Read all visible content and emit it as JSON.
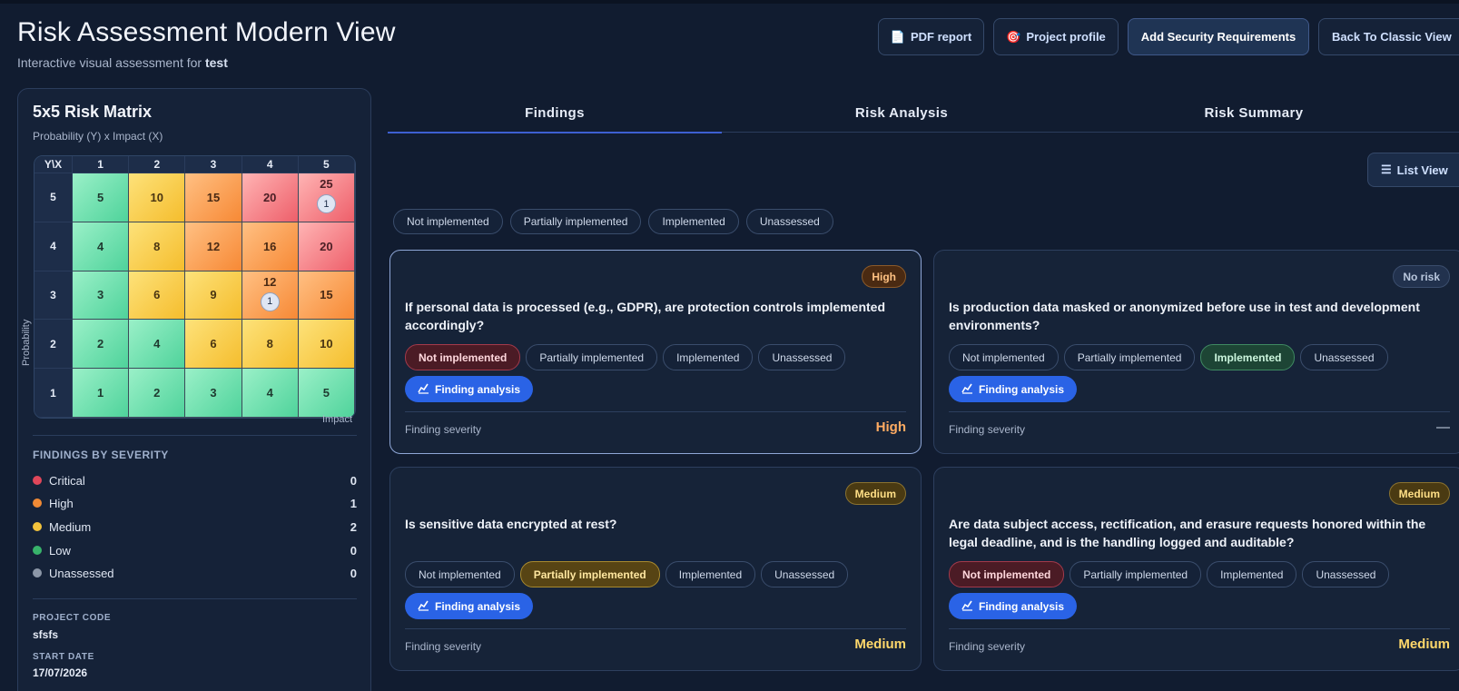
{
  "header": {
    "title": "Risk Assessment Modern View",
    "subtitle_prefix": "Interactive visual assessment for",
    "subtitle_project": "test",
    "buttons": {
      "pdf": "PDF report",
      "profile": "Project profile",
      "add_req": "Add Security Requirements",
      "classic": "Back To Classic View"
    }
  },
  "matrix": {
    "title": "5x5 Risk Matrix",
    "subtitle": "Probability (Y) x Impact (X)",
    "corner": "Y\\X",
    "x_headers": [
      "1",
      "2",
      "3",
      "4",
      "5"
    ],
    "rows": [
      {
        "y": "5",
        "cells": [
          "5",
          "10",
          "15",
          "20",
          "25"
        ]
      },
      {
        "y": "4",
        "cells": [
          "4",
          "8",
          "12",
          "16",
          "20"
        ]
      },
      {
        "y": "3",
        "cells": [
          "3",
          "6",
          "9",
          "12",
          "15"
        ]
      },
      {
        "y": "2",
        "cells": [
          "2",
          "4",
          "6",
          "8",
          "10"
        ]
      },
      {
        "y": "1",
        "cells": [
          "1",
          "2",
          "3",
          "4",
          "5"
        ]
      }
    ],
    "markers": {
      "p5_i5": "1",
      "p3_i4": "1"
    },
    "y_axis_label": "Probability",
    "x_axis_label": "Impact"
  },
  "severity": {
    "title": "FINDINGS BY SEVERITY",
    "items": [
      {
        "label": "Critical",
        "count": "0",
        "color": "#e0475a"
      },
      {
        "label": "High",
        "count": "1",
        "color": "#f08a35"
      },
      {
        "label": "Medium",
        "count": "2",
        "color": "#f3c33c"
      },
      {
        "label": "Low",
        "count": "0",
        "color": "#38b36b"
      },
      {
        "label": "Unassessed",
        "count": "0",
        "color": "#8c97a8"
      }
    ]
  },
  "project": {
    "code_label": "PROJECT CODE",
    "code": "sfsfs",
    "start_label": "START DATE",
    "start": "17/07/2026"
  },
  "tabs": [
    "Findings",
    "Risk Analysis",
    "Risk Summary"
  ],
  "list_view": "List View",
  "filters": [
    "Not implemented",
    "Partially implemented",
    "Implemented",
    "Unassessed"
  ],
  "status_options": [
    "Not implemented",
    "Partially implemented",
    "Implemented",
    "Unassessed"
  ],
  "finding_analysis": "Finding analysis",
  "severity_label": "Finding severity",
  "cards": [
    {
      "badge": "High",
      "question": "If personal data is processed (e.g., GDPR), are protection controls implemented accordingly?",
      "active": "Not implemented",
      "severity": "High"
    },
    {
      "badge": "No risk",
      "question": "Is production data masked or anonymized before use in test and development environments?",
      "active": "Implemented",
      "severity": "—"
    },
    {
      "badge": "Medium",
      "question": "Is sensitive data encrypted at rest?",
      "active": "Partially implemented",
      "severity": "Medium"
    },
    {
      "badge": "Medium",
      "question": "Are data subject access, rectification, and erasure requests honored within the legal deadline, and is the handling logged and auditable?",
      "active": "Not implemented",
      "severity": "Medium"
    }
  ]
}
